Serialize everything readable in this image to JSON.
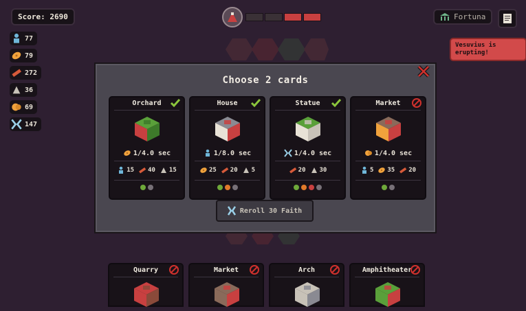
{
  "hud": {
    "score": "Score: 2690",
    "resources": [
      {
        "icon": "population-icon",
        "value": "77",
        "color": "#6fb6d8"
      },
      {
        "icon": "food-icon",
        "value": "79",
        "color": "#f0a23c"
      },
      {
        "icon": "wood-icon",
        "value": "272",
        "color": "#d65a3a"
      },
      {
        "icon": "stone-icon",
        "value": "36",
        "color": "#c8c2b8"
      },
      {
        "icon": "gold-icon",
        "value": "69",
        "color": "#f0a23c"
      },
      {
        "icon": "faith-icon",
        "value": "147",
        "color": "#9ad0e8"
      }
    ],
    "health_segments": [
      "#3a3136",
      "#3a3136",
      "#c84040",
      "#c84040"
    ],
    "deity": "Fortuna",
    "alert": "Vesuvius is erupting!"
  },
  "modal": {
    "title": "Choose 2 cards",
    "reroll_label": "Reroll 30 Faith"
  },
  "cards": [
    {
      "name": "Orchard",
      "status": "selected",
      "rate_icon": "food-icon",
      "rate": "1/4.0 sec",
      "stats": [
        {
          "icon": "population-icon",
          "value": "15",
          "color": "#6fb6d8"
        },
        {
          "icon": "wood-icon",
          "value": "40",
          "color": "#d65a3a"
        },
        {
          "icon": "stone-icon",
          "value": "15",
          "color": "#c8c2b8"
        }
      ],
      "dots": [
        "#6ea83a",
        "#777077"
      ],
      "art_colors": [
        "#5aa03a",
        "#3d7a2a",
        "#c84040"
      ]
    },
    {
      "name": "House",
      "status": "selected",
      "rate_icon": "population-icon",
      "rate": "1/8.0 sec",
      "stats": [
        {
          "icon": "food-icon",
          "value": "25",
          "color": "#f0a23c"
        },
        {
          "icon": "wood-icon",
          "value": "20",
          "color": "#d65a3a"
        },
        {
          "icon": "stone-icon",
          "value": "5",
          "color": "#c8c2b8"
        }
      ],
      "dots": [
        "#6ea83a",
        "#e07a2a",
        "#777077"
      ],
      "art_colors": [
        "#8a8a92",
        "#c84040",
        "#e8e2d6"
      ]
    },
    {
      "name": "Statue",
      "status": "selected",
      "rate_icon": "faith-icon",
      "rate": "1/4.0 sec",
      "stats": [
        {
          "icon": "wood-icon",
          "value": "20",
          "color": "#d65a3a"
        },
        {
          "icon": "stone-icon",
          "value": "30",
          "color": "#c8c2b8"
        }
      ],
      "dots": [
        "#6ea83a",
        "#e07a2a",
        "#c84040",
        "#777077"
      ],
      "art_colors": [
        "#5aa03a",
        "#c8c2b8",
        "#e8e2d6"
      ]
    },
    {
      "name": "Market",
      "status": "blocked",
      "rate_icon": "gold-icon",
      "rate": "1/4.0 sec",
      "stats": [
        {
          "icon": "population-icon",
          "value": "5",
          "color": "#6fb6d8"
        },
        {
          "icon": "food-icon",
          "value": "35",
          "color": "#f0a23c"
        },
        {
          "icon": "wood-icon",
          "value": "20",
          "color": "#d65a3a"
        }
      ],
      "dots": [
        "#6ea83a",
        "#777077"
      ],
      "art_colors": [
        "#8a6a5a",
        "#c84040",
        "#f0a23c"
      ]
    }
  ],
  "hand": [
    {
      "name": "Quarry",
      "art_colors": [
        "#c84040",
        "#8a4a3a"
      ]
    },
    {
      "name": "Market",
      "art_colors": [
        "#8a6a5a",
        "#c84040"
      ]
    },
    {
      "name": "Arch",
      "art_colors": [
        "#c8c2b8",
        "#8a8a92"
      ]
    },
    {
      "name": "Amphitheater",
      "art_colors": [
        "#5aa03a",
        "#c84040"
      ]
    }
  ],
  "colors": {
    "check": "#8cc63c",
    "block": "#d0312d",
    "modal_bg": "#4a4750",
    "card_bg": "#181218"
  }
}
